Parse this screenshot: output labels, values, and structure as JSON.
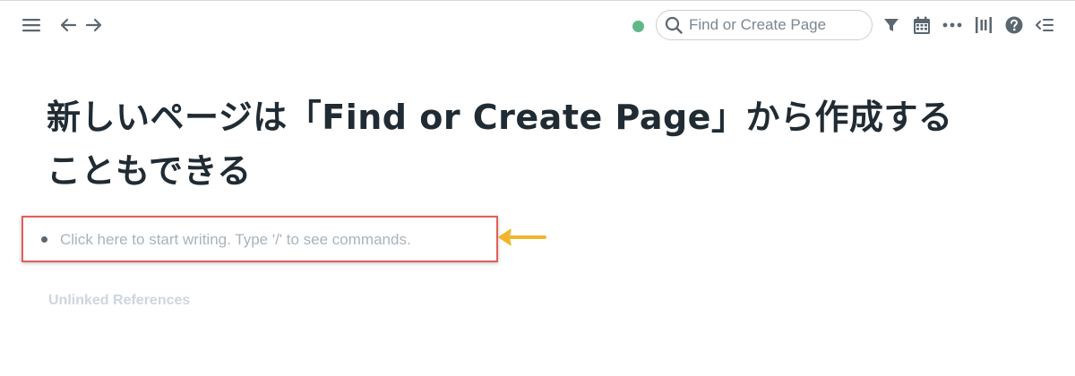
{
  "topbar": {
    "search": {
      "placeholder": "Find or Create Page",
      "value": ""
    },
    "sync_status_color": "#5fb987",
    "icons": {
      "menu": "hamburger-menu-icon",
      "back": "arrow-left-icon",
      "forward": "arrow-right-icon",
      "search": "search-icon",
      "filter": "filter-icon",
      "daily_notes": "calendar-icon",
      "more": "more-options-icon",
      "sidebar": "right-sidebar-icon",
      "help": "help-icon",
      "outdent": "collapse-sidebar-icon"
    }
  },
  "page": {
    "title_line1": "新しいページは「Find or Create Page」から作成する",
    "title_line2": "こともできる"
  },
  "block": {
    "placeholder": "Click here to start writing. Type '/' to see commands.",
    "highlight_color": "#e0605a",
    "arrow_color": "#f2b52b"
  },
  "references": {
    "unlinked_label": "Unlinked References"
  }
}
